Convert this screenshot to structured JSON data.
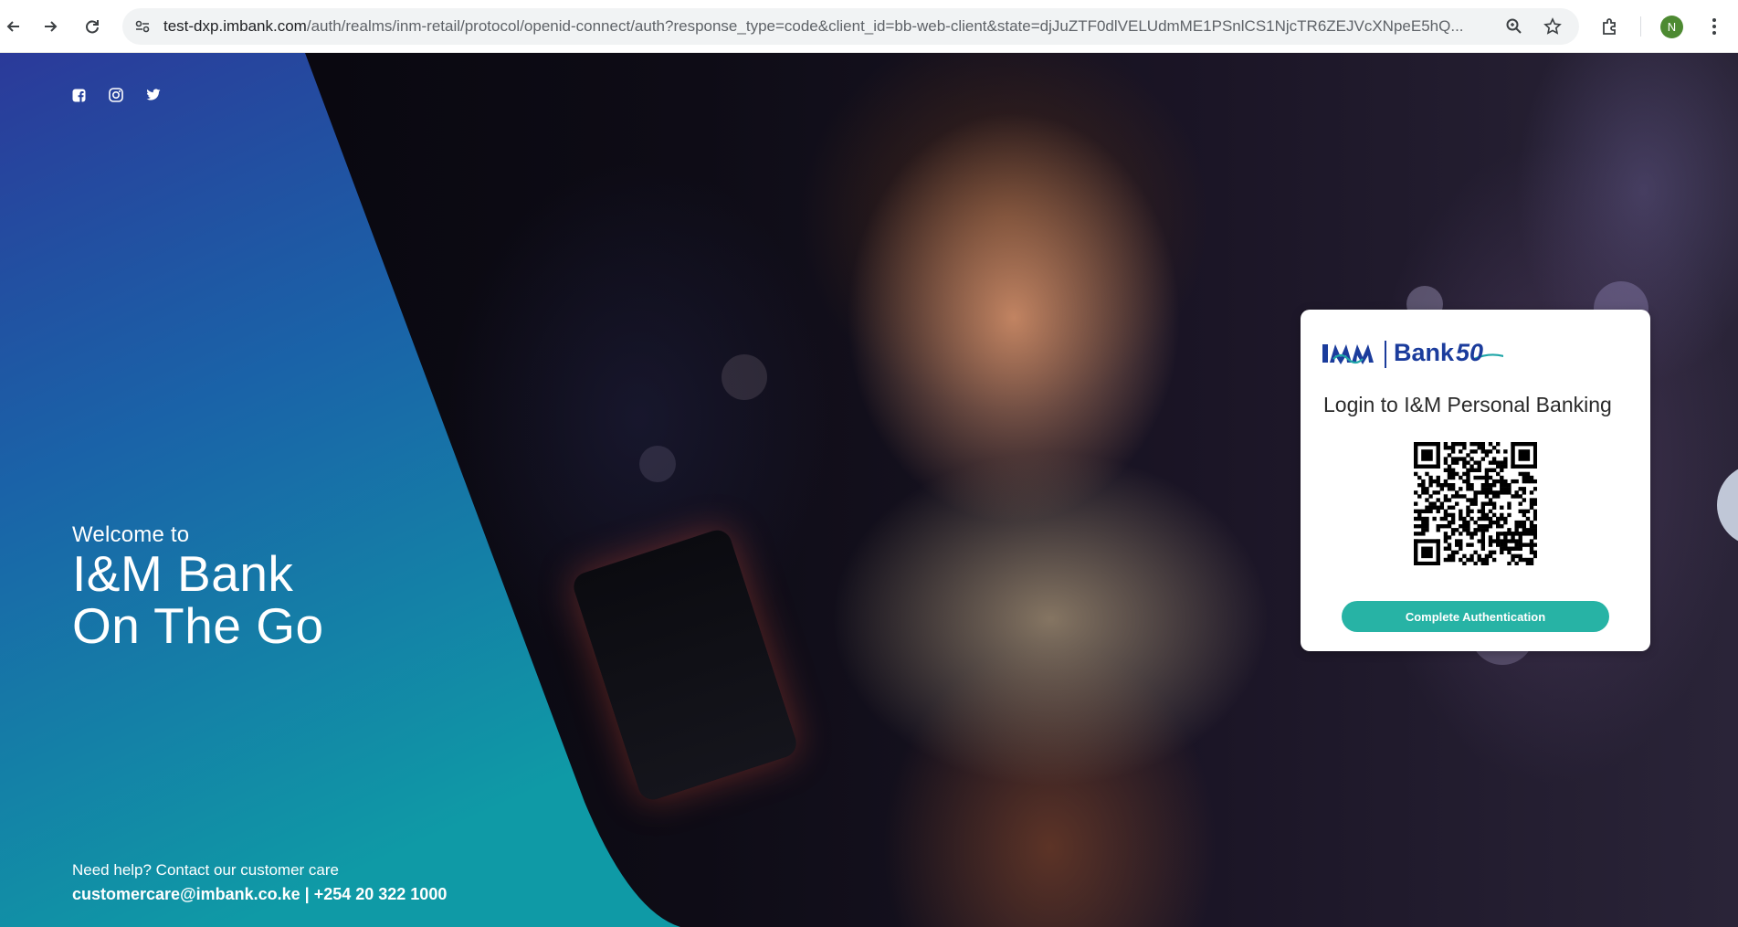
{
  "browser": {
    "url_host": "test-dxp.imbank.com",
    "url_rest": "/auth/realms/inm-retail/protocol/openid-connect/auth?response_type=code&client_id=bb-web-client&state=djJuZTF0dlVELUdmME1PSnlCS1NjcTR6ZEJVcXNpeE5hQ...",
    "profile_initial": "N",
    "icons": [
      "back-arrow-icon",
      "forward-arrow-icon",
      "reload-icon",
      "site-settings-icon",
      "zoom-icon",
      "bookmark-star-icon",
      "extensions-icon",
      "more-menu-icon"
    ]
  },
  "social": {
    "icons": [
      "facebook-icon",
      "instagram-icon",
      "twitter-icon"
    ]
  },
  "hero": {
    "welcome_small": "Welcome to",
    "welcome_line1": "I&M Bank",
    "welcome_line2": "On The Go"
  },
  "footer": {
    "help_text": "Need help? Contact our customer care",
    "contact_text": "customercare@imbank.co.ke | +254 20 322 1000"
  },
  "card": {
    "logo_text": "Bank",
    "logo_number": "50",
    "title": "Login to I&M Personal Banking",
    "button_label": "Complete Authentication"
  },
  "colors": {
    "panel_top": "#2b3a9a",
    "panel_bottom": "#0f9aa6",
    "button": "#27b3a5",
    "logo_blue": "#1b3c9c",
    "logo_teal": "#1fa6a8"
  }
}
